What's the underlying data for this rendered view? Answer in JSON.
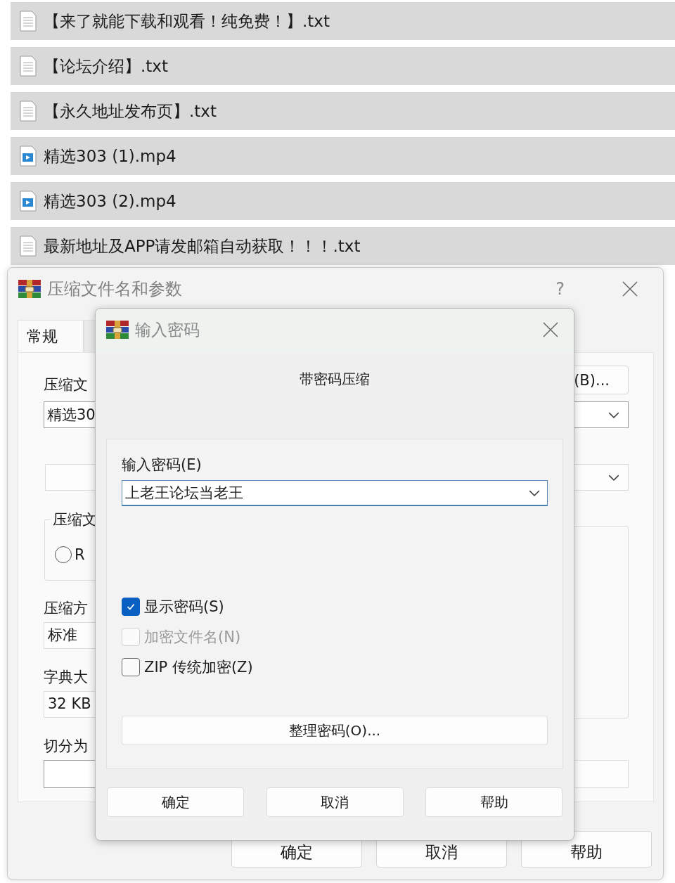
{
  "files": [
    {
      "name": "【来了就能下载和观看！纯免费！】.txt",
      "kind": "text"
    },
    {
      "name": "【论坛介绍】.txt",
      "kind": "text"
    },
    {
      "name": "【永久地址发布页】.txt",
      "kind": "text"
    },
    {
      "name": "精选303 (1).mp4",
      "kind": "video"
    },
    {
      "name": "精选303 (2).mp4",
      "kind": "video"
    },
    {
      "name": "最新地址及APP请发邮箱自动获取！！！.txt",
      "kind": "text"
    }
  ],
  "archive_dialog": {
    "title": "压缩文件名和参数",
    "help": "?",
    "tabs": [
      {
        "label": "常规",
        "selected": true
      },
      {
        "selected": false
      }
    ],
    "archive_label": "压缩文",
    "archive_name": "精选30",
    "browse_button": "(B)...",
    "format_group": "压缩文",
    "format_radio": {
      "label": "R",
      "selected": false
    },
    "method_label": "压缩方",
    "method": "标准",
    "dict_label": "字典大",
    "dict": "32 KB",
    "split_label": "切分为",
    "buttons": [
      "确定",
      "取消",
      "帮助"
    ]
  },
  "password_dialog": {
    "title": "输入密码",
    "heading": "带密码压缩",
    "password_label": "输入密码(E)",
    "password": "上老王论坛当老王",
    "options": [
      {
        "label": "显示密码(S)",
        "checked": true,
        "disabled": false
      },
      {
        "label": "加密文件名(N)",
        "checked": false,
        "disabled": true
      },
      {
        "label": "ZIP 传统加密(Z)",
        "checked": false,
        "disabled": false
      }
    ],
    "organize_button": "整理密码(O)...",
    "buttons": [
      "确定",
      "取消",
      "帮助"
    ]
  }
}
